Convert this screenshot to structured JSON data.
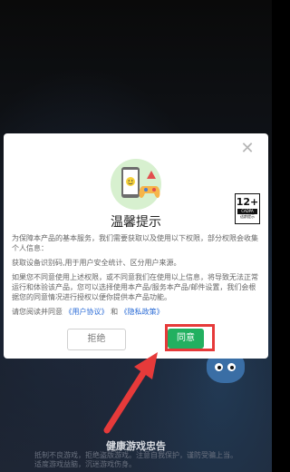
{
  "dialog": {
    "title": "温馨提示",
    "age_rating": {
      "number": "12+",
      "label": "CADPA",
      "sublabel": "适龄提示"
    },
    "paragraphs": [
      "为保障本产品的基本服务，我们需要获取以及使用以下权限，部分权限会收集个人信息：",
      "获取设备识别码,用于用户安全统计、区分用户来源。",
      "如果您不同意使用上述权限，或不同意我们在使用以上信息，将导致无法正常运行和体验该产品，您可以选择使用本产品/服务本产品/邮件设置，我们会根据您的同意情况进行授权以便你提供本产品功能。"
    ],
    "agreement": {
      "prefix": "请您阅读并同意",
      "link1": "《用户协议》",
      "conj": "和",
      "link2": "《隐私政策》"
    },
    "reject_label": "拒绝",
    "agree_label": "同意",
    "close_icon": "close-icon"
  },
  "background": {
    "title": "健康游戏忠告",
    "text": "抵制不良游戏，拒绝盗版游戏。注意自我保护，谨防受骗上当。适度游戏益脑，沉迷游戏伤身。"
  },
  "colors": {
    "agree_button": "#22b060",
    "highlight": "#e63a3a",
    "link": "#2a6bd6"
  }
}
